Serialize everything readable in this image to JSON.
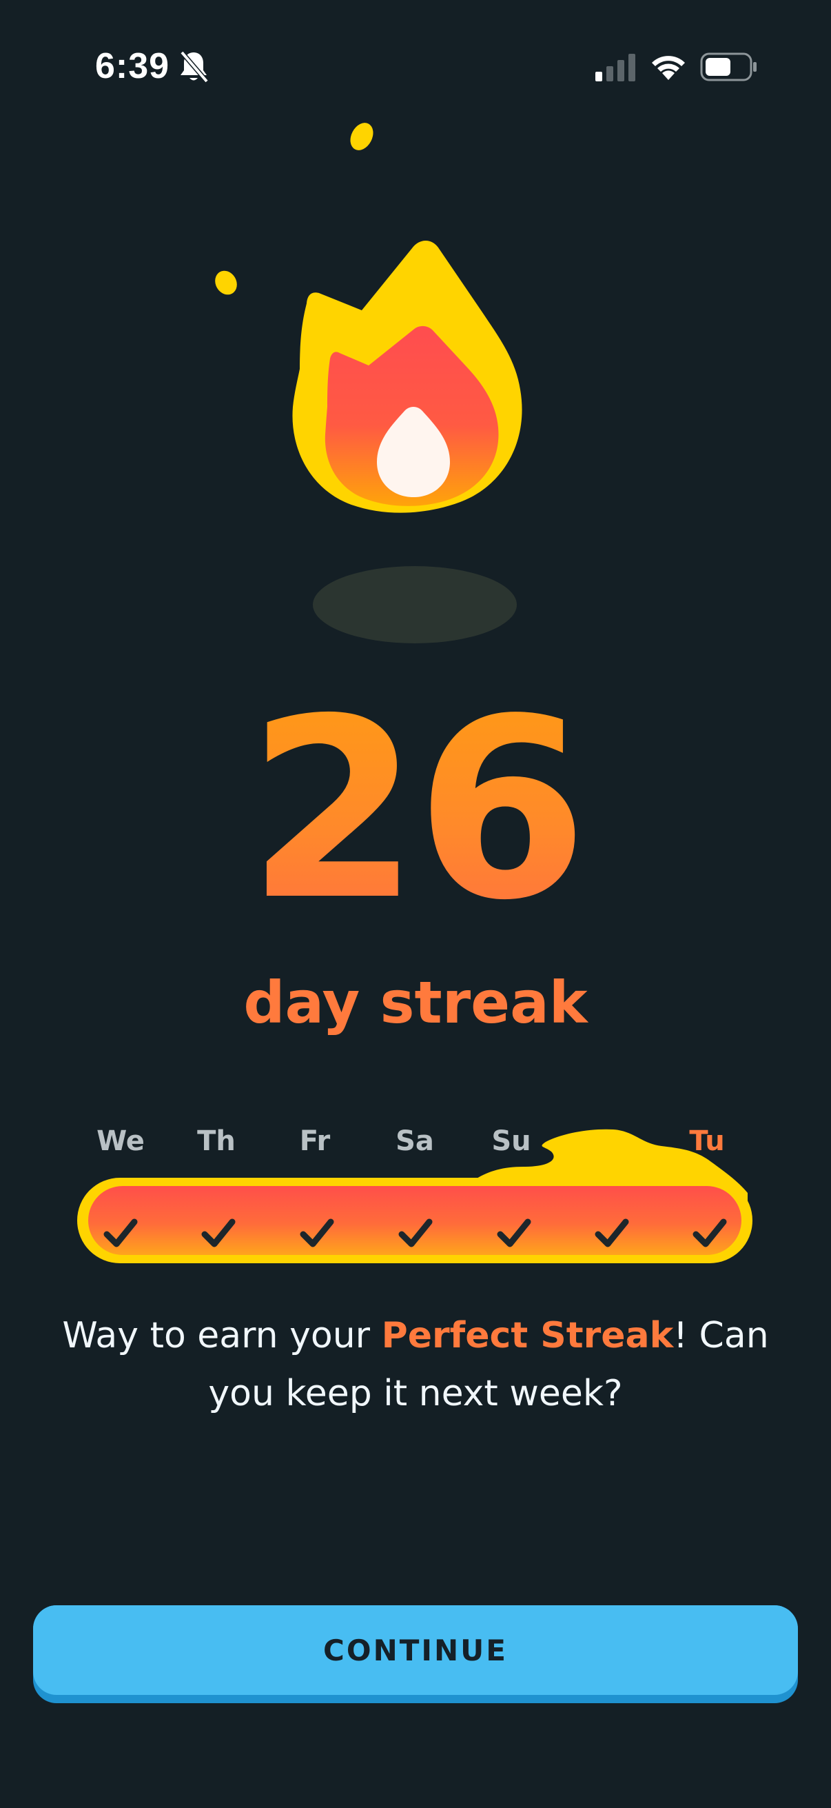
{
  "status_bar": {
    "time": "6:39",
    "icons": [
      "bell-slash-icon",
      "cellular-signal-icon",
      "wifi-icon",
      "battery-icon"
    ]
  },
  "streak": {
    "count": "26",
    "label": "day streak",
    "icon": "flame-icon"
  },
  "week": {
    "days": [
      {
        "label": "We",
        "completed": true,
        "today": false
      },
      {
        "label": "Th",
        "completed": true,
        "today": false
      },
      {
        "label": "Fr",
        "completed": true,
        "today": false
      },
      {
        "label": "Sa",
        "completed": true,
        "today": false
      },
      {
        "label": "Su",
        "completed": true,
        "today": false
      },
      {
        "label": "",
        "completed": true,
        "today": false
      },
      {
        "label": "Tu",
        "completed": true,
        "today": true
      }
    ]
  },
  "message": {
    "prefix": "Way to earn your ",
    "highlight": "Perfect Streak",
    "suffix": "! Can you keep it next week?"
  },
  "continue_button": {
    "label": "CONTINUE"
  },
  "colors": {
    "background": "#141f25",
    "accent_orange": "#ff7a3d",
    "flame_yellow": "#ffd400",
    "flame_red": "#ff4b4b",
    "button_blue": "#48bdf2",
    "button_shadow": "#1f92d0"
  }
}
